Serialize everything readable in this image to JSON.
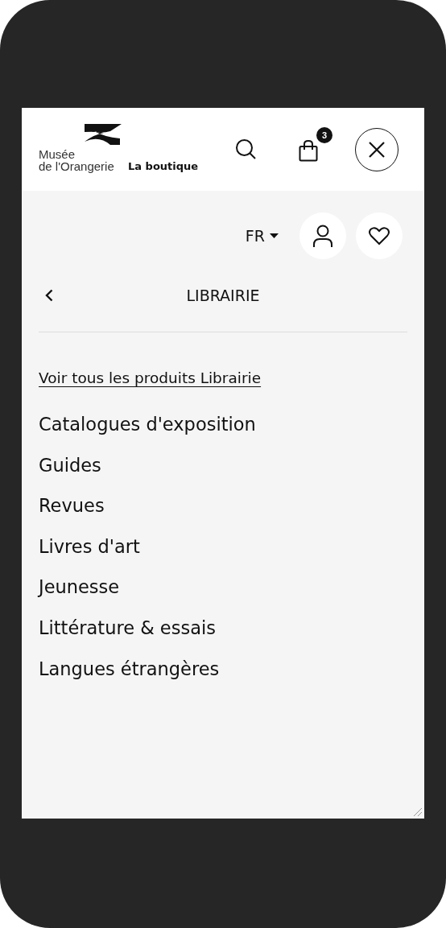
{
  "header": {
    "logo_name": "Musée\nde l'Orangerie",
    "shop_label": "La boutique",
    "cart_count": "3"
  },
  "toolbar": {
    "language": "FR"
  },
  "menu": {
    "title": "LIBRAIRIE",
    "see_all": "Voir tous les produits Librairie",
    "items": [
      {
        "label": "Catalogues d'exposition"
      },
      {
        "label": "Guides"
      },
      {
        "label": "Revues"
      },
      {
        "label": "Livres d'art"
      },
      {
        "label": "Jeunesse"
      },
      {
        "label": "Littérature & essais"
      },
      {
        "label": "Langues étrangères"
      }
    ]
  }
}
